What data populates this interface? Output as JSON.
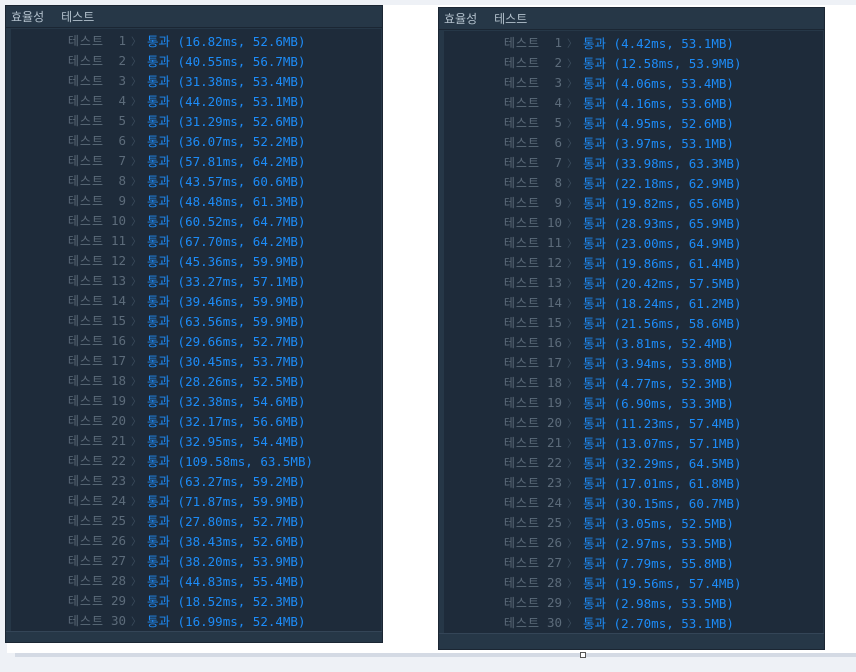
{
  "header": {
    "tab_efficiency": "효율성",
    "tab_test": "테스트"
  },
  "test_word": "테스트",
  "pass_word": "통과",
  "left_results": [
    {
      "n": "1",
      "r": "(16.82ms, 52.6MB)"
    },
    {
      "n": "2",
      "r": "(40.55ms, 56.7MB)"
    },
    {
      "n": "3",
      "r": "(31.38ms, 53.4MB)"
    },
    {
      "n": "4",
      "r": "(44.20ms, 53.1MB)"
    },
    {
      "n": "5",
      "r": "(31.29ms, 52.6MB)"
    },
    {
      "n": "6",
      "r": "(36.07ms, 52.2MB)"
    },
    {
      "n": "7",
      "r": "(57.81ms, 64.2MB)"
    },
    {
      "n": "8",
      "r": "(43.57ms, 60.6MB)"
    },
    {
      "n": "9",
      "r": "(48.48ms, 61.3MB)"
    },
    {
      "n": "10",
      "r": "(60.52ms, 64.7MB)"
    },
    {
      "n": "11",
      "r": "(67.70ms, 64.2MB)"
    },
    {
      "n": "12",
      "r": "(45.36ms, 59.9MB)"
    },
    {
      "n": "13",
      "r": "(33.27ms, 57.1MB)"
    },
    {
      "n": "14",
      "r": "(39.46ms, 59.9MB)"
    },
    {
      "n": "15",
      "r": "(63.56ms, 59.9MB)"
    },
    {
      "n": "16",
      "r": "(29.66ms, 52.7MB)"
    },
    {
      "n": "17",
      "r": "(30.45ms, 53.7MB)"
    },
    {
      "n": "18",
      "r": "(28.26ms, 52.5MB)"
    },
    {
      "n": "19",
      "r": "(32.38ms, 54.6MB)"
    },
    {
      "n": "20",
      "r": "(32.17ms, 56.6MB)"
    },
    {
      "n": "21",
      "r": "(32.95ms, 54.4MB)"
    },
    {
      "n": "22",
      "r": "(109.58ms, 63.5MB)"
    },
    {
      "n": "23",
      "r": "(63.27ms, 59.2MB)"
    },
    {
      "n": "24",
      "r": "(71.87ms, 59.9MB)"
    },
    {
      "n": "25",
      "r": "(27.80ms, 52.7MB)"
    },
    {
      "n": "26",
      "r": "(38.43ms, 52.6MB)"
    },
    {
      "n": "27",
      "r": "(38.20ms, 53.9MB)"
    },
    {
      "n": "28",
      "r": "(44.83ms, 55.4MB)"
    },
    {
      "n": "29",
      "r": "(18.52ms, 52.3MB)"
    },
    {
      "n": "30",
      "r": "(16.99ms, 52.4MB)"
    }
  ],
  "right_results": [
    {
      "n": "1",
      "r": "(4.42ms, 53.1MB)"
    },
    {
      "n": "2",
      "r": "(12.58ms, 53.9MB)"
    },
    {
      "n": "3",
      "r": "(4.06ms, 53.4MB)"
    },
    {
      "n": "4",
      "r": "(4.16ms, 53.6MB)"
    },
    {
      "n": "5",
      "r": "(4.95ms, 52.6MB)"
    },
    {
      "n": "6",
      "r": "(3.97ms, 53.1MB)"
    },
    {
      "n": "7",
      "r": "(33.98ms, 63.3MB)"
    },
    {
      "n": "8",
      "r": "(22.18ms, 62.9MB)"
    },
    {
      "n": "9",
      "r": "(19.82ms, 65.6MB)"
    },
    {
      "n": "10",
      "r": "(28.93ms, 65.9MB)"
    },
    {
      "n": "11",
      "r": "(23.00ms, 64.9MB)"
    },
    {
      "n": "12",
      "r": "(19.86ms, 61.4MB)"
    },
    {
      "n": "13",
      "r": "(20.42ms, 57.5MB)"
    },
    {
      "n": "14",
      "r": "(18.24ms, 61.2MB)"
    },
    {
      "n": "15",
      "r": "(21.56ms, 58.6MB)"
    },
    {
      "n": "16",
      "r": "(3.81ms, 52.4MB)"
    },
    {
      "n": "17",
      "r": "(3.94ms, 53.8MB)"
    },
    {
      "n": "18",
      "r": "(4.77ms, 52.3MB)"
    },
    {
      "n": "19",
      "r": "(6.90ms, 53.3MB)"
    },
    {
      "n": "20",
      "r": "(11.23ms, 57.4MB)"
    },
    {
      "n": "21",
      "r": "(13.07ms, 57.1MB)"
    },
    {
      "n": "22",
      "r": "(32.29ms, 64.5MB)"
    },
    {
      "n": "23",
      "r": "(17.01ms, 61.8MB)"
    },
    {
      "n": "24",
      "r": "(30.15ms, 60.7MB)"
    },
    {
      "n": "25",
      "r": "(3.05ms, 52.5MB)"
    },
    {
      "n": "26",
      "r": "(2.97ms, 53.5MB)"
    },
    {
      "n": "27",
      "r": "(7.79ms, 55.8MB)"
    },
    {
      "n": "28",
      "r": "(19.56ms, 57.4MB)"
    },
    {
      "n": "29",
      "r": "(2.98ms, 53.5MB)"
    },
    {
      "n": "30",
      "r": "(2.70ms, 53.1MB)"
    }
  ],
  "colors": {
    "panel_bg": "#263747",
    "list_bg": "#1e2b3a",
    "label": "#5c6b7a",
    "result": "#1d8cf8"
  },
  "icons": {
    "row_chevron": "chevron-right-icon"
  }
}
